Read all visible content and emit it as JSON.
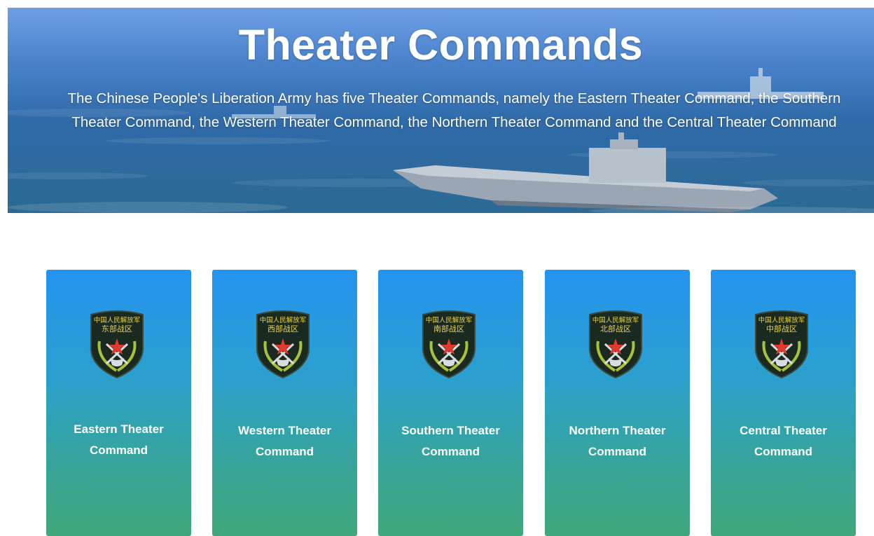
{
  "hero": {
    "title": "Theater Commands",
    "description": "The Chinese People's Liberation Army has five Theater Commands, namely the Eastern Theater Command, the Southern Theater Command, the Western Theater Command, the Northern Theater Command and the Central Theater Command"
  },
  "cards": [
    {
      "label": "Eastern Theater Command",
      "emblem_line1": "中国人民解放军",
      "emblem_line2": "东部战区"
    },
    {
      "label": "Western Theater Command",
      "emblem_line1": "中国人民解放军",
      "emblem_line2": "西部战区"
    },
    {
      "label": "Southern Theater Command",
      "emblem_line1": "中国人民解放军",
      "emblem_line2": "南部战区"
    },
    {
      "label": "Northern Theater Command",
      "emblem_line1": "中国人民解放军",
      "emblem_line2": "北部战区"
    },
    {
      "label": "Central Theater Command",
      "emblem_line1": "中国人民解放军",
      "emblem_line2": "中部战区"
    }
  ],
  "colors": {
    "card_top": "#2493ef",
    "card_bottom": "#3fa77a",
    "emblem_text": "#e8d24a",
    "emblem_shield": "#1b2a20",
    "emblem_star": "#e23a2e",
    "emblem_laurel": "#a8c23c"
  },
  "icons": {
    "emblem": "shield-emblem-icon"
  }
}
